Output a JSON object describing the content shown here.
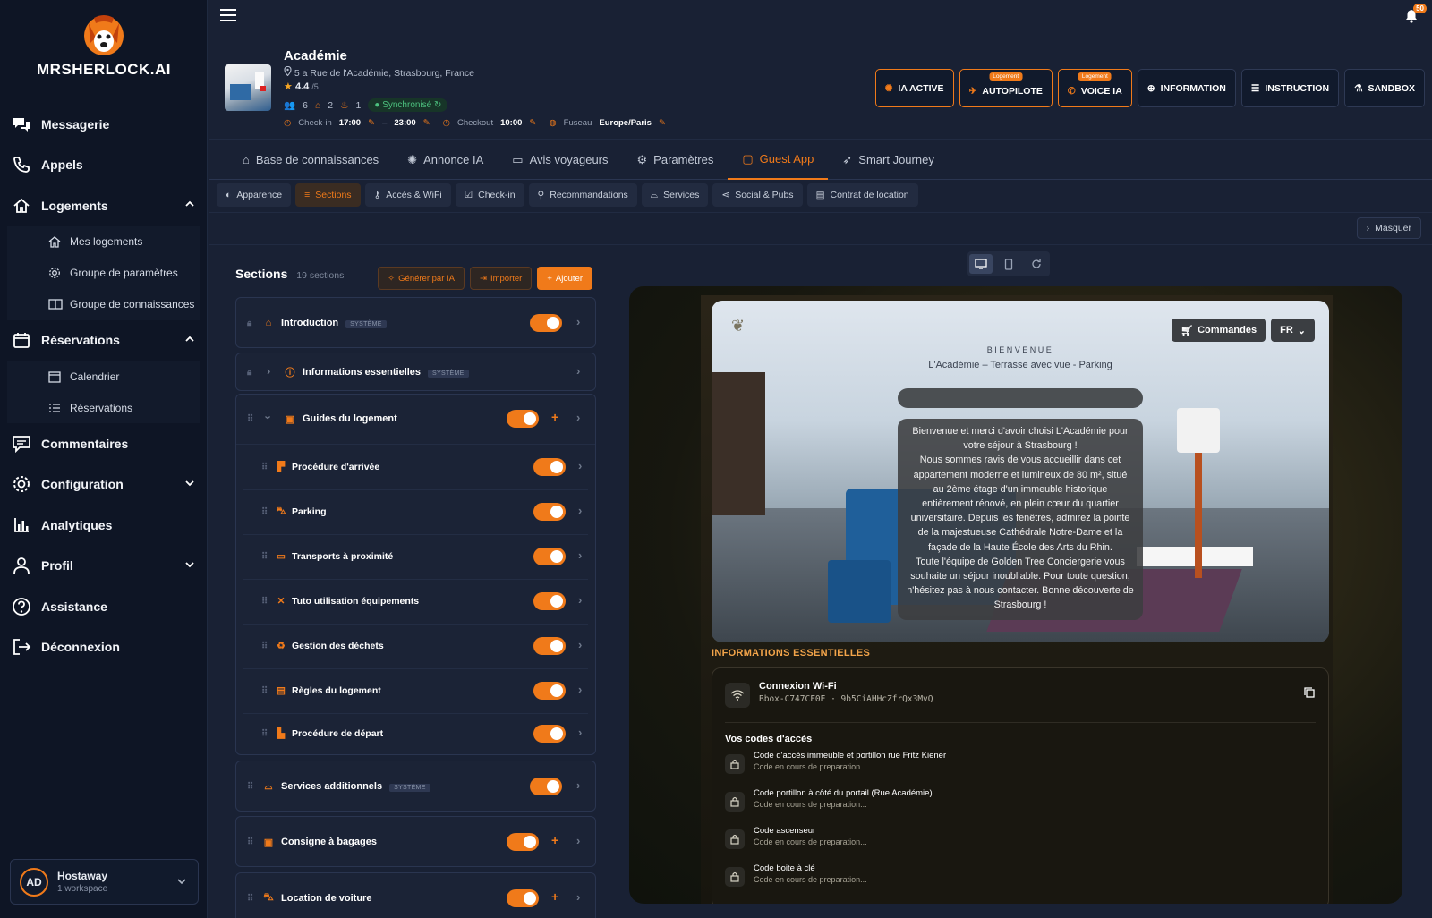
{
  "brand": {
    "name": "MRSHERLOCK.AI"
  },
  "nav": [
    {
      "label": "Messagerie",
      "icon": "chat-icon"
    },
    {
      "label": "Appels",
      "icon": "phone-icon"
    },
    {
      "label": "Logements",
      "icon": "home-icon",
      "expanded": true
    },
    {
      "label": "Réservations",
      "icon": "calendar-icon",
      "expanded": true
    },
    {
      "label": "Commentaires",
      "icon": "comment-icon"
    },
    {
      "label": "Configuration",
      "icon": "gear-icon"
    },
    {
      "label": "Analytiques",
      "icon": "chart-icon"
    },
    {
      "label": "Profil",
      "icon": "user-icon"
    },
    {
      "label": "Assistance",
      "icon": "help-icon"
    },
    {
      "label": "Déconnexion",
      "icon": "logout-icon"
    }
  ],
  "logements_sub": [
    "Mes logements",
    "Groupe de paramètres",
    "Groupe de connaissances"
  ],
  "reservations_sub": [
    "Calendrier",
    "Réservations"
  ],
  "workspace": {
    "initials": "AD",
    "name": "Hostaway",
    "count": "1 workspace"
  },
  "notifications": {
    "count": "50"
  },
  "property": {
    "name": "Académie",
    "address": "5 a Rue de l'Académie, Strasbourg, France",
    "rating": "4.4",
    "rating_max": "/5",
    "guests": "6",
    "bedrooms": "2",
    "beds": "1",
    "sync": "Synchronisé",
    "checkin_label": "Check-in",
    "checkin": "17:00",
    "checkin_end": "23:00",
    "checkout_label": "Checkout",
    "checkout": "10:00",
    "tz_label": "Fuseau",
    "tz": "Europe/Paris"
  },
  "top_buttons": [
    {
      "label": "IA ACTIVE",
      "tag": "",
      "highlight": true
    },
    {
      "label": "AUTOPILOTE",
      "tag": "Logement",
      "highlight": true
    },
    {
      "label": "VOICE IA",
      "tag": "Logement",
      "highlight": true
    },
    {
      "label": "INFORMATION",
      "tag": "",
      "highlight": false
    },
    {
      "label": "INSTRUCTION",
      "tag": "",
      "highlight": false
    },
    {
      "label": "SANDBOX",
      "tag": "",
      "highlight": false
    }
  ],
  "tabs": [
    "Base de connaissances",
    "Annonce IA",
    "Avis voyageurs",
    "Paramètres",
    "Guest App",
    "Smart Journey"
  ],
  "active_tab": "Guest App",
  "subtabs": [
    "Apparence",
    "Sections",
    "Accès & WiFi",
    "Check-in",
    "Recommandations",
    "Services",
    "Social & Pubs",
    "Contrat de location"
  ],
  "active_subtab": "Sections",
  "masquer": "Masquer",
  "sections_panel": {
    "title": "Sections",
    "count": "19 sections",
    "btn_generate": "Générer par IA",
    "btn_import": "Importer",
    "btn_add": "Ajouter",
    "system_badge": "SYSTÈME"
  },
  "sections": [
    {
      "label": "Introduction",
      "system": true,
      "toggle": true
    },
    {
      "label": "Informations essentielles",
      "system": true,
      "toggle": false
    },
    {
      "label": "Guides du logement",
      "system": false,
      "toggle": true,
      "children": [
        "Procédure d'arrivée",
        "Parking",
        "Transports à proximité",
        "Tuto utilisation équipements",
        "Gestion des déchets",
        "Règles du logement",
        "Procédure de départ"
      ]
    },
    {
      "label": "Services additionnels",
      "system": true,
      "toggle": true
    },
    {
      "label": "Consigne à bagages",
      "system": false,
      "toggle": true
    },
    {
      "label": "Location de voiture",
      "system": false,
      "toggle": true
    }
  ],
  "preview": {
    "commandes": "Commandes",
    "lang": "FR",
    "bienvenue": "BIENVENUE",
    "subtitle": "L'Académie – Terrasse avec vue - Parking",
    "welcome_lines": [
      "Bienvenue et merci d'avoir choisi L'Académie pour",
      "votre séjour à Strasbourg !",
      "Nous sommes ravis de vous accueillir dans cet",
      "appartement moderne et lumineux de 80 m², situé",
      "au 2ème étage d'un immeuble historique",
      "entièrement rénové, en plein cœur du quartier",
      "universitaire. Depuis les fenêtres, admirez la pointe",
      "de la majestueuse Cathédrale Notre-Dame et la",
      "façade de la Haute École des Arts du Rhin.",
      "Toute l'équipe de Golden Tree Conciergerie vous",
      "souhaite un séjour inoubliable. Pour toute question,",
      "n'hésitez pas à nous contacter. Bonne découverte de",
      "Strasbourg !"
    ],
    "info_title": "INFORMATIONS ESSENTIELLES",
    "wifi_title": "Connexion Wi-Fi",
    "wifi_ssid": "Bbox-C747CF0E",
    "wifi_pass": "9b5CiAHHcZfrQx3MvQ",
    "codes_title": "Vos codes d'accès",
    "codes": [
      {
        "name": "Code d'accès immeuble et portillon rue Fritz Kiener",
        "status": "Code en cours de preparation..."
      },
      {
        "name": "Code portillon à côté du portail (Rue Académie)",
        "status": "Code en cours de preparation..."
      },
      {
        "name": "Code ascenseur",
        "status": "Code en cours de preparation..."
      },
      {
        "name": "Code boite à clé",
        "status": "Code en cours de preparation..."
      }
    ]
  },
  "colors": {
    "accent": "#f07a1a",
    "bg": "#192134",
    "sidebar": "#0e1525",
    "success": "#4cc07e"
  }
}
